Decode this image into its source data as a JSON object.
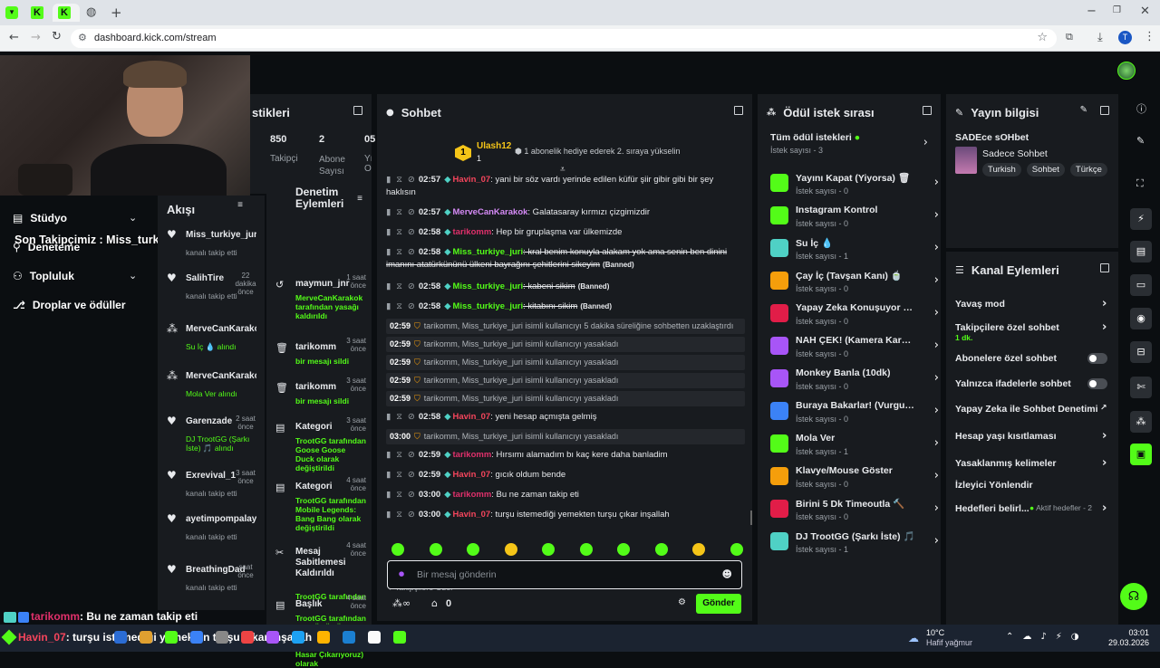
{
  "browser": {
    "url": "dashboard.kick.com/stream",
    "profile_initial": "T"
  },
  "stats_panel": {
    "title": "stikleri",
    "followers": "850",
    "followers_label": "Takipçi",
    "subs": "2",
    "subs_label": "Abone Sayısı",
    "third_val": "05",
    "third_label": "Yı Ol"
  },
  "overlay": {
    "latest_follower": "Son Takipçimiz : Miss_turkiye_juri"
  },
  "left_nav": [
    {
      "label": "Stüdyo"
    },
    {
      "label": "Deneteme"
    },
    {
      "label": "Topluluk"
    },
    {
      "label": "Droplar ve ödüller"
    }
  ],
  "activity": {
    "title": "Akışı",
    "items": [
      {
        "name": "Miss_turkiye_juri",
        "sub": "kanalı takip etti",
        "time": ""
      },
      {
        "name": "SalihTire",
        "sub": "kanalı takip etti",
        "time": "22 dakika önce"
      },
      {
        "name": "MerveCanKarako",
        "sub": "Su İç 💧 alındı",
        "time": ""
      },
      {
        "name": "MerveCanKarako",
        "sub": "Mola Ver alındı",
        "time": ""
      },
      {
        "name": "Garenzade",
        "sub": "DJ TrootGG (Şarkı İste) 🎵 alındı",
        "time": "2 saat önce"
      },
      {
        "name": "Exrevival_1",
        "sub": "kanalı takip etti",
        "time": "3 saat önce"
      },
      {
        "name": "ayetimpompalay",
        "sub": "kanalı takip etti",
        "time": ""
      },
      {
        "name": "BreathingDad",
        "sub": "kanalı takip etti",
        "time": "saat önce"
      }
    ]
  },
  "moderation": {
    "title": "Denetim Eylemleri",
    "items": [
      {
        "name": "maymun_jnr",
        "desc": "MerveCanKarakok tarafından yasağı kaldırıldı",
        "time": "1 saat önce"
      },
      {
        "name": "tarikomm",
        "desc": "bir mesajı sildi",
        "time": "3 saat önce"
      },
      {
        "name": "tarikomm",
        "desc": "bir mesajı sildi",
        "time": "3 saat önce"
      },
      {
        "name": "Kategori",
        "desc": "TrootGG tarafından Goose Goose Duck olarak değiştirildi",
        "time": "3 saat önce"
      },
      {
        "name": "Kategori",
        "desc": "TrootGG tarafından Mobile Legends: Bang Bang olarak değiştirildi",
        "time": "4 saat önce"
      },
      {
        "name": "Mesaj Sabitlemesi Kaldırıldı",
        "desc": "TrootGG tarafından",
        "time": "4 saat önce"
      },
      {
        "name": "Başlık",
        "desc": "TrootGG tarafından BU BÜYÜCÜYLE KAYBETMEK İMKANSIZ! (İllegal Hasar Çıkarıyoruz) olarak",
        "time": "4 saat önce"
      }
    ]
  },
  "chat": {
    "title": "Sohbet",
    "top_user": "Ulash12",
    "top_count": "1",
    "banner": "1 abonelik hediye ederek 2. sıraya yükselin",
    "messages": [
      {
        "time": "02:57",
        "user": "Havin_07",
        "color": "#f5455c",
        "text": ": yani bir söz vardı yerinde edilen küfür şiir gibir gibi bir şey haklısın",
        "strike": false
      },
      {
        "time": "02:57",
        "user": "MerveCanKarakok",
        "color": "#d58af6",
        "text": ": Galatasaray kırmızı çizgimizdir",
        "strike": false
      },
      {
        "time": "02:58",
        "user": "tarikomm",
        "color": "#e0306b",
        "text": ": Hep bir gruplaşma var ülkemizde",
        "strike": false
      },
      {
        "time": "02:58",
        "user": "Miss_turkiye_juri",
        "color": "#53fc18",
        "text": ": kral benim konuyla alakam yok ama senin ben dinini imanını atatürkününü ülkeni bayrağını şehitlerini sikeyim",
        "strike": true,
        "tag": "(Banned)"
      },
      {
        "time": "02:58",
        "user": "Miss_turkiye_juri",
        "color": "#53fc18",
        "text": ": kabeni sikim",
        "strike": true,
        "tag": "(Banned)"
      },
      {
        "time": "02:58",
        "user": "Miss_turkiye_juri",
        "color": "#53fc18",
        "text": ": kitabını sikim",
        "strike": true,
        "tag": "(Banned)"
      }
    ],
    "system": [
      {
        "time": "02:59",
        "text": "tarikomm, Miss_turkiye_juri isimli kullanıcıyı 5 dakika süreliğine sohbetten uzaklaştırdı"
      },
      {
        "time": "02:59",
        "text": "tarikomm, Miss_turkiye_juri isimli kullanıcıyı yasakladı"
      },
      {
        "time": "02:59",
        "text": "tarikomm, Miss_turkiye_juri isimli kullanıcıyı yasakladı"
      },
      {
        "time": "02:59",
        "text": "tarikomm, Miss_turkiye_juri isimli kullanıcıyı yasakladı"
      },
      {
        "time": "02:59",
        "text": "tarikomm, Miss_turkiye_juri isimli kullanıcıyı yasakladı"
      }
    ],
    "messages2": [
      {
        "time": "02:58",
        "user": "Havin_07",
        "color": "#f5455c",
        "text": ": yeni hesap açmışta gelmiş"
      },
      {
        "time": "02:59",
        "user": "tarikomm",
        "color": "#e0306b",
        "text": ": Hırsımı alamadım bı kaç kere daha banladim"
      },
      {
        "time": "02:59",
        "user": "Havin_07",
        "color": "#f5455c",
        "text": ": gıcık oldum bende"
      },
      {
        "time": "03:00",
        "user": "tarikomm",
        "color": "#e0306b",
        "text": ": Bu ne zaman takip eti"
      },
      {
        "time": "03:00",
        "user": "Havin_07",
        "color": "#f5455c",
        "text": ": turşu istemediği yemekten turşu çıkar inşallah"
      }
    ],
    "sys_last": {
      "time": "03:00",
      "text": "tarikomm, Miss_turkiye_juri isimli kullanıcıyı yasakladı"
    },
    "followers_only": "Takipçilere Özel",
    "input_placeholder": "Bir mesaj gönderin",
    "points": "0",
    "send": "Gönder"
  },
  "rewards": {
    "title": "Ödül istek sırası",
    "all_label": "Tüm ödül istekleri",
    "all_count": "İstek sayısı - 3",
    "items": [
      {
        "title": "Yayını Kapat (Yiyorsa) 🗑",
        "count": "İstek sayısı - 0",
        "color": "#53fc18"
      },
      {
        "title": "Instagram Kontrol",
        "count": "İstek sayısı - 0",
        "color": "#53fc18"
      },
      {
        "title": "Su İç 💧",
        "count": "İstek sayısı - 1",
        "color": "#4fd1c5"
      },
      {
        "title": "Çay İç (Tavşan Kanı) 🍵",
        "count": "İstek sayısı - 0",
        "color": "#f59e0b"
      },
      {
        "title": "Yapay Zeka Konuşuyor (TT…",
        "count": "İstek sayısı - 0",
        "color": "#e11d48"
      },
      {
        "title": "NAH ÇEK! (Kamera Karşısı…",
        "count": "İstek sayısı - 0",
        "color": "#a855f7"
      },
      {
        "title": "Monkey Banla (10dk)",
        "count": "İstek sayısı - 0",
        "color": "#a855f7"
      },
      {
        "title": "Buraya Bakarlar! (Vurgulu …",
        "count": "İstek sayısı - 0",
        "color": "#3b82f6"
      },
      {
        "title": "Mola Ver",
        "count": "İstek sayısı - 1",
        "color": "#53fc18"
      },
      {
        "title": "Klavye/Mouse Göster",
        "count": "İstek sayısı - 0",
        "color": "#f59e0b"
      },
      {
        "title": "Birini 5 Dk Timeoutla 🔨",
        "count": "İstek sayısı - 0",
        "color": "#e11d48"
      },
      {
        "title": "DJ TrootGG (Şarkı İste) 🎵",
        "count": "İstek sayısı - 1",
        "color": "#4fd1c5"
      }
    ]
  },
  "stream_info": {
    "title": "Yayın bilgisi",
    "stream_title": "SADEce sOHbet",
    "category": "Sadece Sohbet",
    "tags": [
      "Turkish",
      "Sohbet",
      "Türkçe"
    ]
  },
  "channel_actions": {
    "title": "Kanal Eylemleri",
    "items": [
      {
        "label": "Yavaş mod",
        "kind": "chevron"
      },
      {
        "label": "Takipçilere özel sohbet",
        "sub": "1 dk.",
        "kind": "chevron"
      },
      {
        "label": "Abonelere özel sohbet",
        "kind": "toggle"
      },
      {
        "label": "Yalnızca ifadelerle sohbet",
        "kind": "toggle"
      },
      {
        "label": "Yapay Zeka ile Sohbet Denetimi",
        "kind": "ext"
      },
      {
        "label": "Hesap yaşı kısıtlaması",
        "kind": "chevron"
      },
      {
        "label": "Yasaklanmış kelimeler",
        "kind": "chevron"
      },
      {
        "label": "İzleyici Yönlendir",
        "kind": "none"
      },
      {
        "label": "Hedefleri belirl...",
        "sub": "Aktif hedefler - 2",
        "kind": "chevron"
      }
    ]
  },
  "feed": [
    {
      "user": "tarikomm",
      "text": ": Bu ne zaman takip eti"
    },
    {
      "user": "Havin_07",
      "text": ": turşu istemediği yemekten turşu çıkar inşallah"
    }
  ],
  "taskbar": {
    "temp": "10°C",
    "weather": "Hafif yağmur",
    "time": "03:01",
    "date": "29.03.2026"
  }
}
